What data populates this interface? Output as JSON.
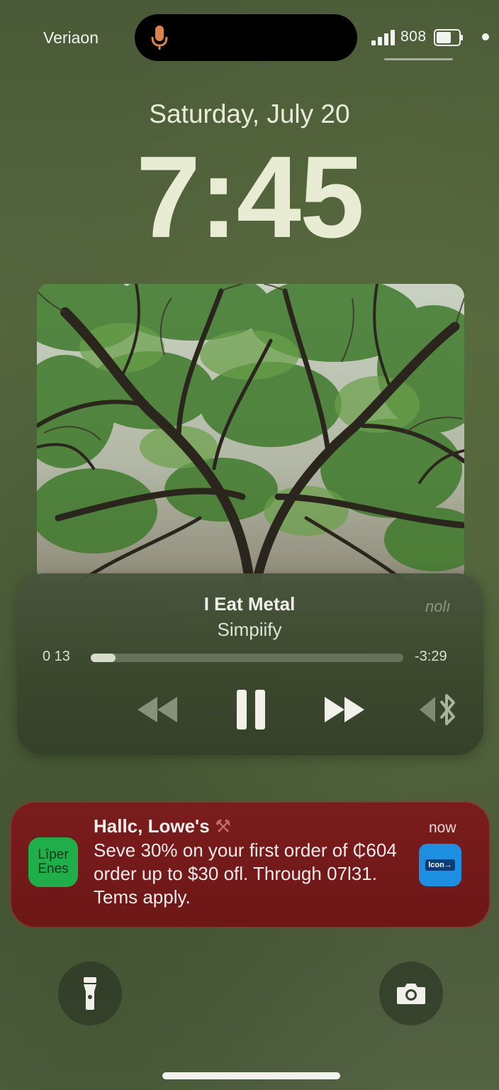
{
  "status_bar": {
    "carrier": "Veriaon",
    "signal_text": "808",
    "mic_color": "#d9844a",
    "icons": [
      "mic-icon",
      "signal-bars-icon",
      "battery-icon",
      "dot-icon"
    ]
  },
  "lock": {
    "date": "Saturday, July 20",
    "time": "7:45"
  },
  "now_playing": {
    "artwork": "tree-canopy-artwork",
    "title": "I Eat Metal",
    "artist": "Simpiify",
    "airplay_label": "nolı",
    "elapsed": "0 13",
    "remaining": "-3:29",
    "progress_fraction": 0.08,
    "controls": [
      "rewind-icon",
      "pause-icon",
      "fast-forward-icon",
      "audio-output-icon"
    ]
  },
  "notification": {
    "app_icon_text": [
      "Lîper",
      "Enes"
    ],
    "app_icon_color": "#1fae4a",
    "title": "Hallc, Lowe's",
    "title_emoji": "⚒",
    "time": "now",
    "body": "Seve 30% on your first order of ₵604 order up to $30 ofl. Through 07l31. Tems apply.",
    "thumbnail_text": "lcon→",
    "background": "#741a1a"
  },
  "bottom": {
    "left_icon": "flashlight-icon",
    "right_icon": "camera-icon"
  }
}
